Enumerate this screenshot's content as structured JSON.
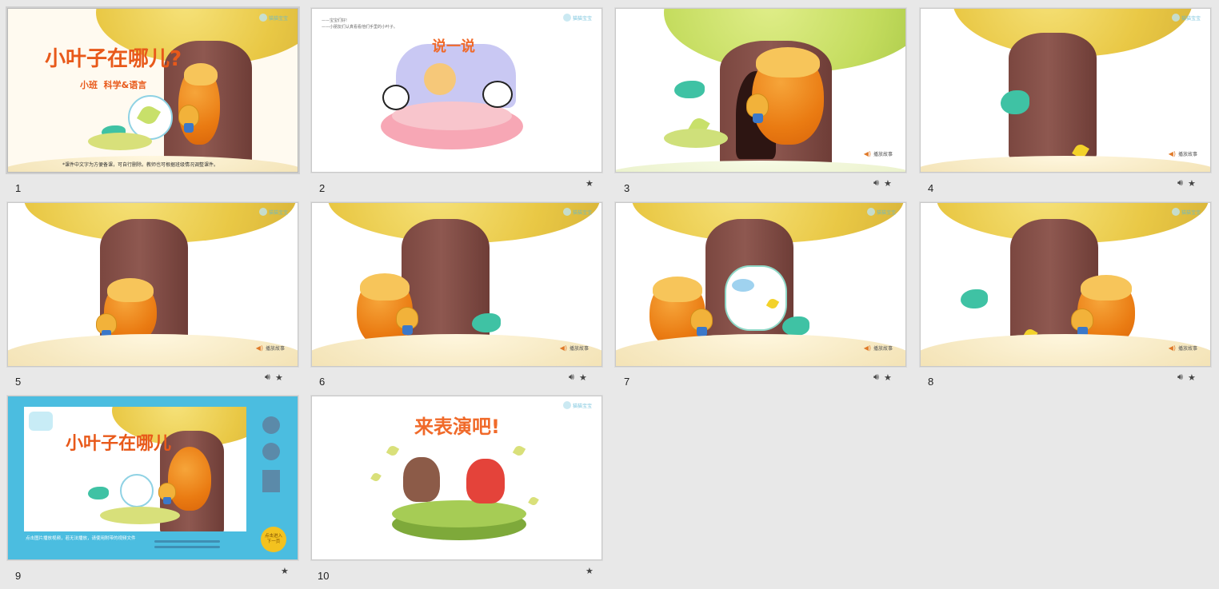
{
  "slides": [
    {
      "number": "1",
      "title": "小叶子在哪儿?",
      "subtitle": "小班  科学&语言",
      "note": "*课件中文字为方便备课，可自行删除。教师也可根据班级情况调整课件。"
    },
    {
      "number": "2",
      "title": "说一说",
      "note_lines": [
        "——宝宝们好!",
        "——小朋友们认真看看他们手里的小叶子。"
      ]
    },
    {
      "number": "3",
      "play_label": "播放故事"
    },
    {
      "number": "4",
      "play_label": "播放故事"
    },
    {
      "number": "5",
      "play_label": "播放故事"
    },
    {
      "number": "6",
      "play_label": "播放故事"
    },
    {
      "number": "7",
      "play_label": "播放故事"
    },
    {
      "number": "8",
      "play_label": "播放故事"
    },
    {
      "number": "9",
      "title": "小叶子在哪儿",
      "caption": "点击图片播放视频，若无法播放，请使用附带的视频文件",
      "next_button": "点击进入下一页",
      "next_button_line1": "点击进入",
      "next_button_line2": "下一页"
    },
    {
      "number": "10",
      "title": "来表演吧!"
    }
  ],
  "logo_text": "猫猫宝宝",
  "icons": {
    "sound": "speaker-icon",
    "star": "star-icon"
  },
  "colors": {
    "title_orange": "#e8591a",
    "slide9_bg": "#4bbde0",
    "workspace": "#e8e8e8"
  }
}
